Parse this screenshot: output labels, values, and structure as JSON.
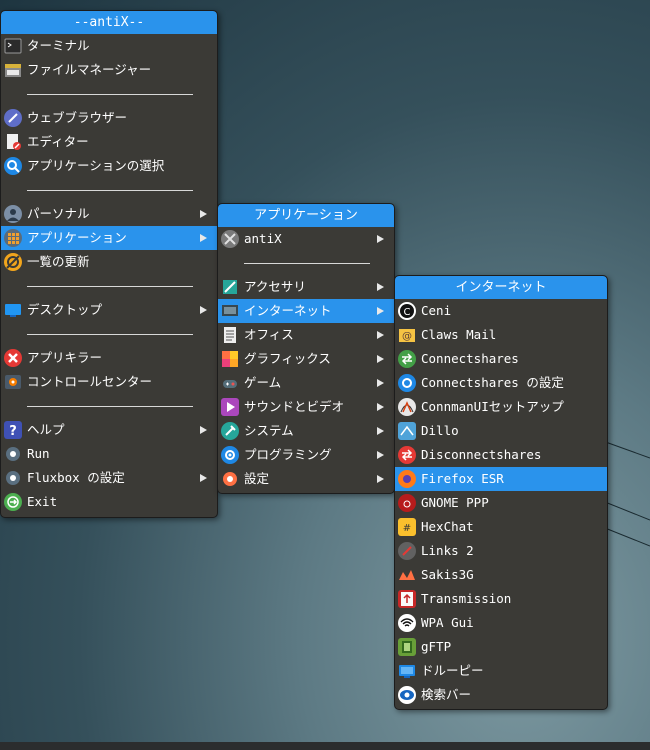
{
  "colors": {
    "accent": "#2a93ec",
    "menu_bg": "#3b3a36",
    "text": "#ffffff"
  },
  "main_menu": {
    "title": "--antiX--",
    "items": [
      {
        "label": "ターミナル",
        "icon": "terminal-icon"
      },
      {
        "label": "ファイルマネージャー",
        "icon": "file-manager-icon"
      },
      {
        "label": "ウェブブラウザー",
        "icon": "web-browser-icon"
      },
      {
        "label": "エディター",
        "icon": "editor-icon"
      },
      {
        "label": "アプリケーションの選択",
        "icon": "app-select-icon"
      },
      {
        "label": "パーソナル",
        "icon": "personal-icon",
        "submenu": true
      },
      {
        "label": "アプリケーション",
        "icon": "applications-icon",
        "submenu": true,
        "active": true
      },
      {
        "label": "一覧の更新",
        "icon": "refresh-icon"
      },
      {
        "label": "デスクトップ",
        "icon": "desktop-icon",
        "submenu": true
      },
      {
        "label": "アプリキラー",
        "icon": "app-killer-icon"
      },
      {
        "label": "コントロールセンター",
        "icon": "control-center-icon"
      },
      {
        "label": "ヘルプ",
        "icon": "help-icon",
        "submenu": true
      },
      {
        "label": "Run",
        "icon": "run-icon"
      },
      {
        "label": "Fluxbox の設定",
        "icon": "fluxbox-settings-icon",
        "submenu": true
      },
      {
        "label": "Exit",
        "icon": "exit-icon"
      }
    ]
  },
  "apps_menu": {
    "title": "アプリケーション",
    "items": [
      {
        "label": "antiX",
        "icon": "antix-icon",
        "submenu": true
      },
      {
        "label": "アクセサリ",
        "icon": "accessories-icon",
        "submenu": true
      },
      {
        "label": "インターネット",
        "icon": "internet-icon",
        "submenu": true,
        "active": true
      },
      {
        "label": "オフィス",
        "icon": "office-icon",
        "submenu": true
      },
      {
        "label": "グラフィックス",
        "icon": "graphics-icon",
        "submenu": true
      },
      {
        "label": "ゲーム",
        "icon": "games-icon",
        "submenu": true
      },
      {
        "label": "サウンドとビデオ",
        "icon": "sound-video-icon",
        "submenu": true
      },
      {
        "label": "システム",
        "icon": "system-icon",
        "submenu": true
      },
      {
        "label": "プログラミング",
        "icon": "programming-icon",
        "submenu": true
      },
      {
        "label": "設定",
        "icon": "settings-icon",
        "submenu": true
      }
    ]
  },
  "internet_menu": {
    "title": "インターネット",
    "items": [
      {
        "label": "Ceni",
        "icon": "ceni-icon"
      },
      {
        "label": "Claws Mail",
        "icon": "claws-mail-icon"
      },
      {
        "label": "Connectshares",
        "icon": "connectshares-icon"
      },
      {
        "label": "Connectshares の設定",
        "icon": "connectshares-config-icon"
      },
      {
        "label": "ConnmanUIセットアップ",
        "icon": "connman-icon"
      },
      {
        "label": "Dillo",
        "icon": "dillo-icon"
      },
      {
        "label": "Disconnectshares",
        "icon": "disconnectshares-icon"
      },
      {
        "label": "Firefox ESR",
        "icon": "firefox-icon",
        "active": true
      },
      {
        "label": "GNOME PPP",
        "icon": "gnome-ppp-icon"
      },
      {
        "label": "HexChat",
        "icon": "hexchat-icon"
      },
      {
        "label": "Links 2",
        "icon": "links2-icon"
      },
      {
        "label": "Sakis3G",
        "icon": "sakis3g-icon"
      },
      {
        "label": "Transmission",
        "icon": "transmission-icon"
      },
      {
        "label": "WPA Gui",
        "icon": "wpa-gui-icon"
      },
      {
        "label": "gFTP",
        "icon": "gftp-icon"
      },
      {
        "label": "ドルーピー",
        "icon": "droopy-icon"
      },
      {
        "label": "検索バー",
        "icon": "search-bar-icon"
      }
    ]
  }
}
